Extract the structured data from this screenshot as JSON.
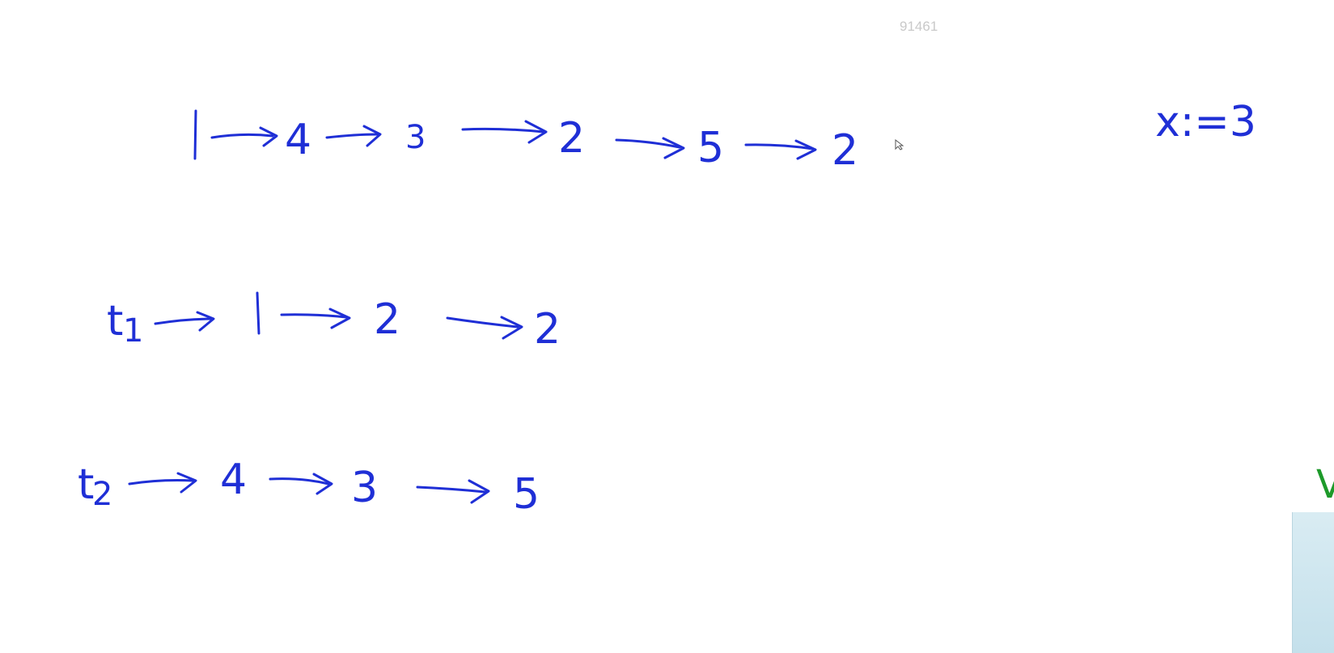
{
  "watermark": "91461",
  "whiteboard": {
    "line1": {
      "nodes": [
        "1",
        "4",
        "3",
        "2",
        "5",
        "2"
      ]
    },
    "annotation": "x:=3",
    "line2": {
      "head": "t",
      "head_sub": "1",
      "nodes": [
        "1",
        "2",
        "2"
      ]
    },
    "line3": {
      "head": "t",
      "head_sub": "2",
      "nodes": [
        "4",
        "3",
        "5"
      ]
    }
  },
  "side_panel": {
    "letter": "V",
    "letter_color": "#1d9a2a"
  },
  "ink_color": "#1f2fd6"
}
